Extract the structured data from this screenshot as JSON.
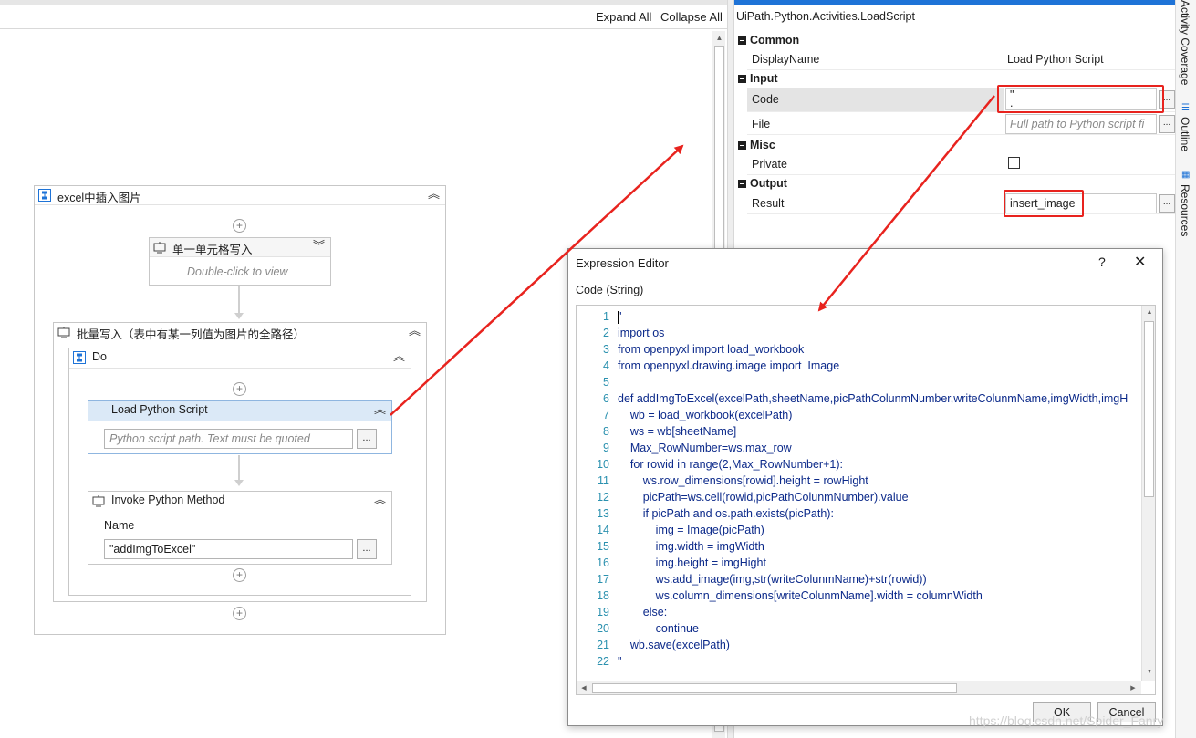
{
  "designer": {
    "expand_all": "Expand All",
    "collapse_all": "Collapse All",
    "sequence_title": "excel中插入图片",
    "single_cell_title": "单一单元格写入",
    "single_cell_hint": "Double-click to view",
    "batch_title": "批量写入（表中有某一列值为图片的全路径）",
    "do_title": "Do",
    "load_script_title": "Load Python Script",
    "load_script_placeholder": "Python script path. Text must be quoted",
    "invoke_title": "Invoke Python Method",
    "invoke_name_label": "Name",
    "invoke_name_value": "\"addImgToExcel\"",
    "dots": "..."
  },
  "properties": {
    "class_name": "UiPath.Python.Activities.LoadScript",
    "categories": {
      "common": "Common",
      "input": "Input",
      "misc": "Misc",
      "output": "Output"
    },
    "rows": {
      "display_name_label": "DisplayName",
      "display_name_value": "Load Python Script",
      "code_label": "Code",
      "code_value": "\"\n.",
      "file_label": "File",
      "file_placeholder": "Full path to Python script fi",
      "private_label": "Private",
      "result_label": "Result",
      "result_value": "insert_image"
    },
    "private_checked": false
  },
  "side_tabs": {
    "activity_coverage": "Activity Coverage",
    "outline": "Outline",
    "resources": "Resources"
  },
  "expression_editor": {
    "title": "Expression Editor",
    "help": "?",
    "close": "✕",
    "subtitle": "Code (String)",
    "lines": [
      "\"",
      "import os",
      "from openpyxl import load_workbook",
      "from openpyxl.drawing.image import  Image",
      "",
      "def addImgToExcel(excelPath,sheetName,picPathColunmNumber,writeColunmName,imgWidth,imgH",
      "    wb = load_workbook(excelPath)",
      "    ws = wb[sheetName]",
      "    Max_RowNumber=ws.max_row",
      "    for rowid in range(2,Max_RowNumber+1):",
      "        ws.row_dimensions[rowid].height = rowHight",
      "        picPath=ws.cell(rowid,picPathColunmNumber).value",
      "        if picPath and os.path.exists(picPath):",
      "            img = Image(picPath)",
      "            img.width = imgWidth",
      "            img.height = imgHight",
      "            ws.add_image(img,str(writeColunmName)+str(rowid))",
      "            ws.column_dimensions[writeColunmName].width = columnWidth",
      "        else:",
      "            continue",
      "    wb.save(excelPath)",
      "\""
    ],
    "ok": "OK",
    "cancel": "Cancel"
  },
  "watermark": "https://blog.csdn.net/Spider_Fanry",
  "colors": {
    "accent": "#1e73d7",
    "annotation_red": "#e8231e",
    "code_text": "#0c2a8a",
    "line_number": "#2b91af",
    "selected_activity": "#dbe9f7"
  },
  "icons": {
    "sequence": "sequence-icon",
    "activity": "activity-icon",
    "collapse": "double-chevron-up-icon",
    "expand": "double-chevron-down-icon",
    "add": "add-circle-icon"
  }
}
